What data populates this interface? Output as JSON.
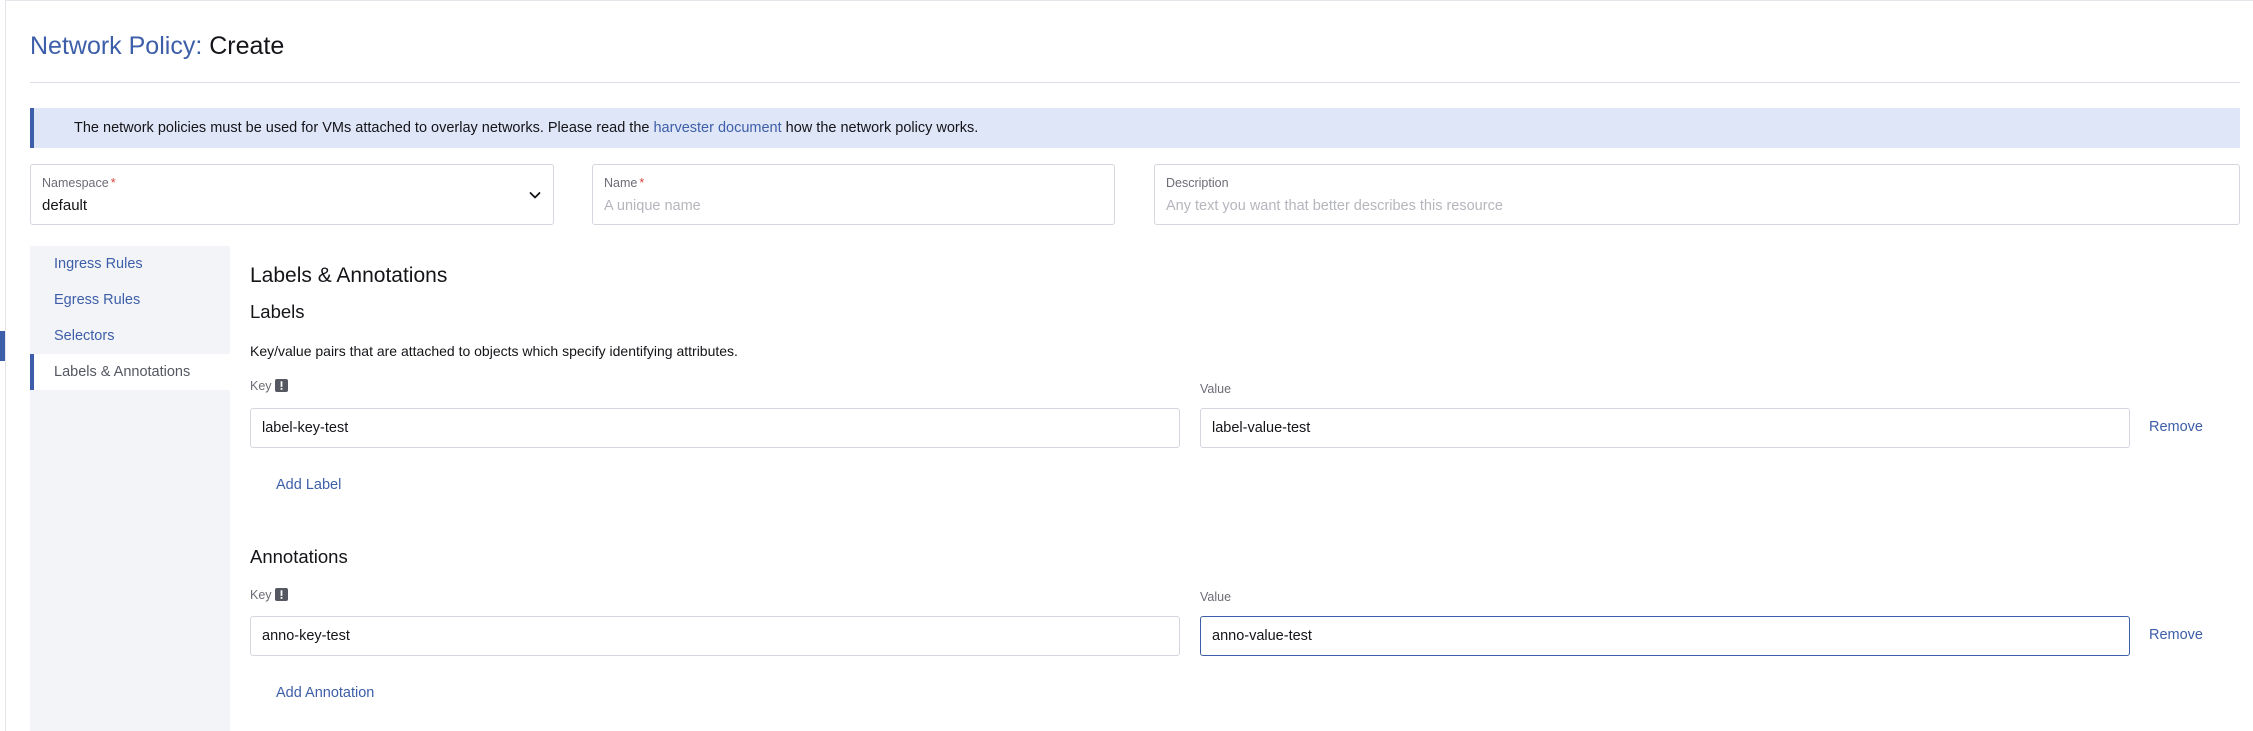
{
  "header": {
    "resource_type": "Network Policy:",
    "action": "Create"
  },
  "banner": {
    "text_before": "The network policies must be used for VMs attached to overlay networks. Please read the ",
    "link_text": "harvester document",
    "text_after": " how the network policy works."
  },
  "fields": {
    "namespace": {
      "label": "Namespace",
      "required_mark": "*",
      "value": "default"
    },
    "name": {
      "label": "Name",
      "required_mark": "*",
      "placeholder": "A unique name"
    },
    "description": {
      "label": "Description",
      "placeholder": "Any text you want that better describes this resource"
    }
  },
  "side_nav": {
    "items": [
      {
        "label": "Ingress Rules"
      },
      {
        "label": "Egress Rules"
      },
      {
        "label": "Selectors"
      },
      {
        "label": "Labels & Annotations"
      }
    ],
    "active": "Labels & Annotations"
  },
  "content": {
    "title": "Labels & Annotations",
    "labels": {
      "heading": "Labels",
      "description": "Key/value pairs that are attached to objects which specify identifying attributes.",
      "key_header": "Key",
      "value_header": "Value",
      "rows": [
        {
          "key": "label-key-test",
          "value": "label-value-test"
        }
      ],
      "remove_label": "Remove",
      "add_label": "Add Label"
    },
    "annotations": {
      "heading": "Annotations",
      "key_header": "Key",
      "value_header": "Value",
      "rows": [
        {
          "key": "anno-key-test",
          "value": "anno-value-test"
        }
      ],
      "remove_label": "Remove",
      "add_label": "Add Annotation"
    }
  },
  "colors": {
    "accent": "#3d5ea8",
    "banner_bg": "#dfe6f7",
    "required": "#d8453c",
    "sidebar_bg": "#f3f4f8"
  },
  "icons": {
    "namespace_dropdown": "chevron-down-icon",
    "key_info": "info-icon"
  }
}
